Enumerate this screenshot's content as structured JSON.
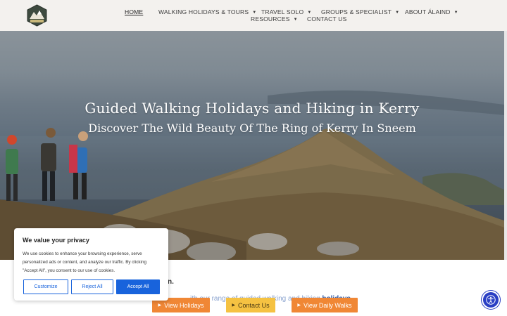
{
  "header": {
    "logo_text": "ALAIND",
    "nav": [
      {
        "label": "HOME",
        "has_caret": false
      },
      {
        "label": "WALKING HOLIDAYS & TOURS",
        "has_caret": true
      },
      {
        "label": "TRAVEL SOLO",
        "has_caret": true
      },
      {
        "label": "GROUPS & SPECIALIST",
        "has_caret": true
      },
      {
        "label": "ABOUT ÁLAIND",
        "has_caret": true
      },
      {
        "label": "RESOURCES",
        "has_caret": true
      },
      {
        "label": "CONTACT US",
        "has_caret": false
      }
    ],
    "caret_glyph": "▼"
  },
  "hero": {
    "title": "Guided Walking Holidays and Hiking in Kerry",
    "subtitle": "Discover The Wild Beauty Of The Ring of Kerry In Sneem"
  },
  "intro": {
    "fragment_right": "n.",
    "line_fragment_mid": "ith our range of guided walking and hiking",
    "line_fragment_link": "holidays",
    "line_fragment_end": "."
  },
  "buttons": {
    "tri_glyph": "▶",
    "view_holidays": "View Holidays",
    "contact_us": "Contact Us",
    "view_daily_walks": "View Daily Walks"
  },
  "cookie": {
    "title": "We value your privacy",
    "body": "We use cookies to enhance your browsing experience, serve personalized ads or content, and analyze our traffic. By clicking \"Accept All\", you consent to our use of cookies.",
    "customize": "Customize",
    "reject": "Reject All",
    "accept": "Accept All"
  },
  "colors": {
    "accent_orange": "#f08735",
    "accent_yellow": "#f5c242",
    "cookie_blue": "#1863dc",
    "a11y_blue": "#2a3fc4"
  },
  "icons": {
    "accessibility": "accessibility-icon",
    "caret": "chevron-down-icon"
  }
}
